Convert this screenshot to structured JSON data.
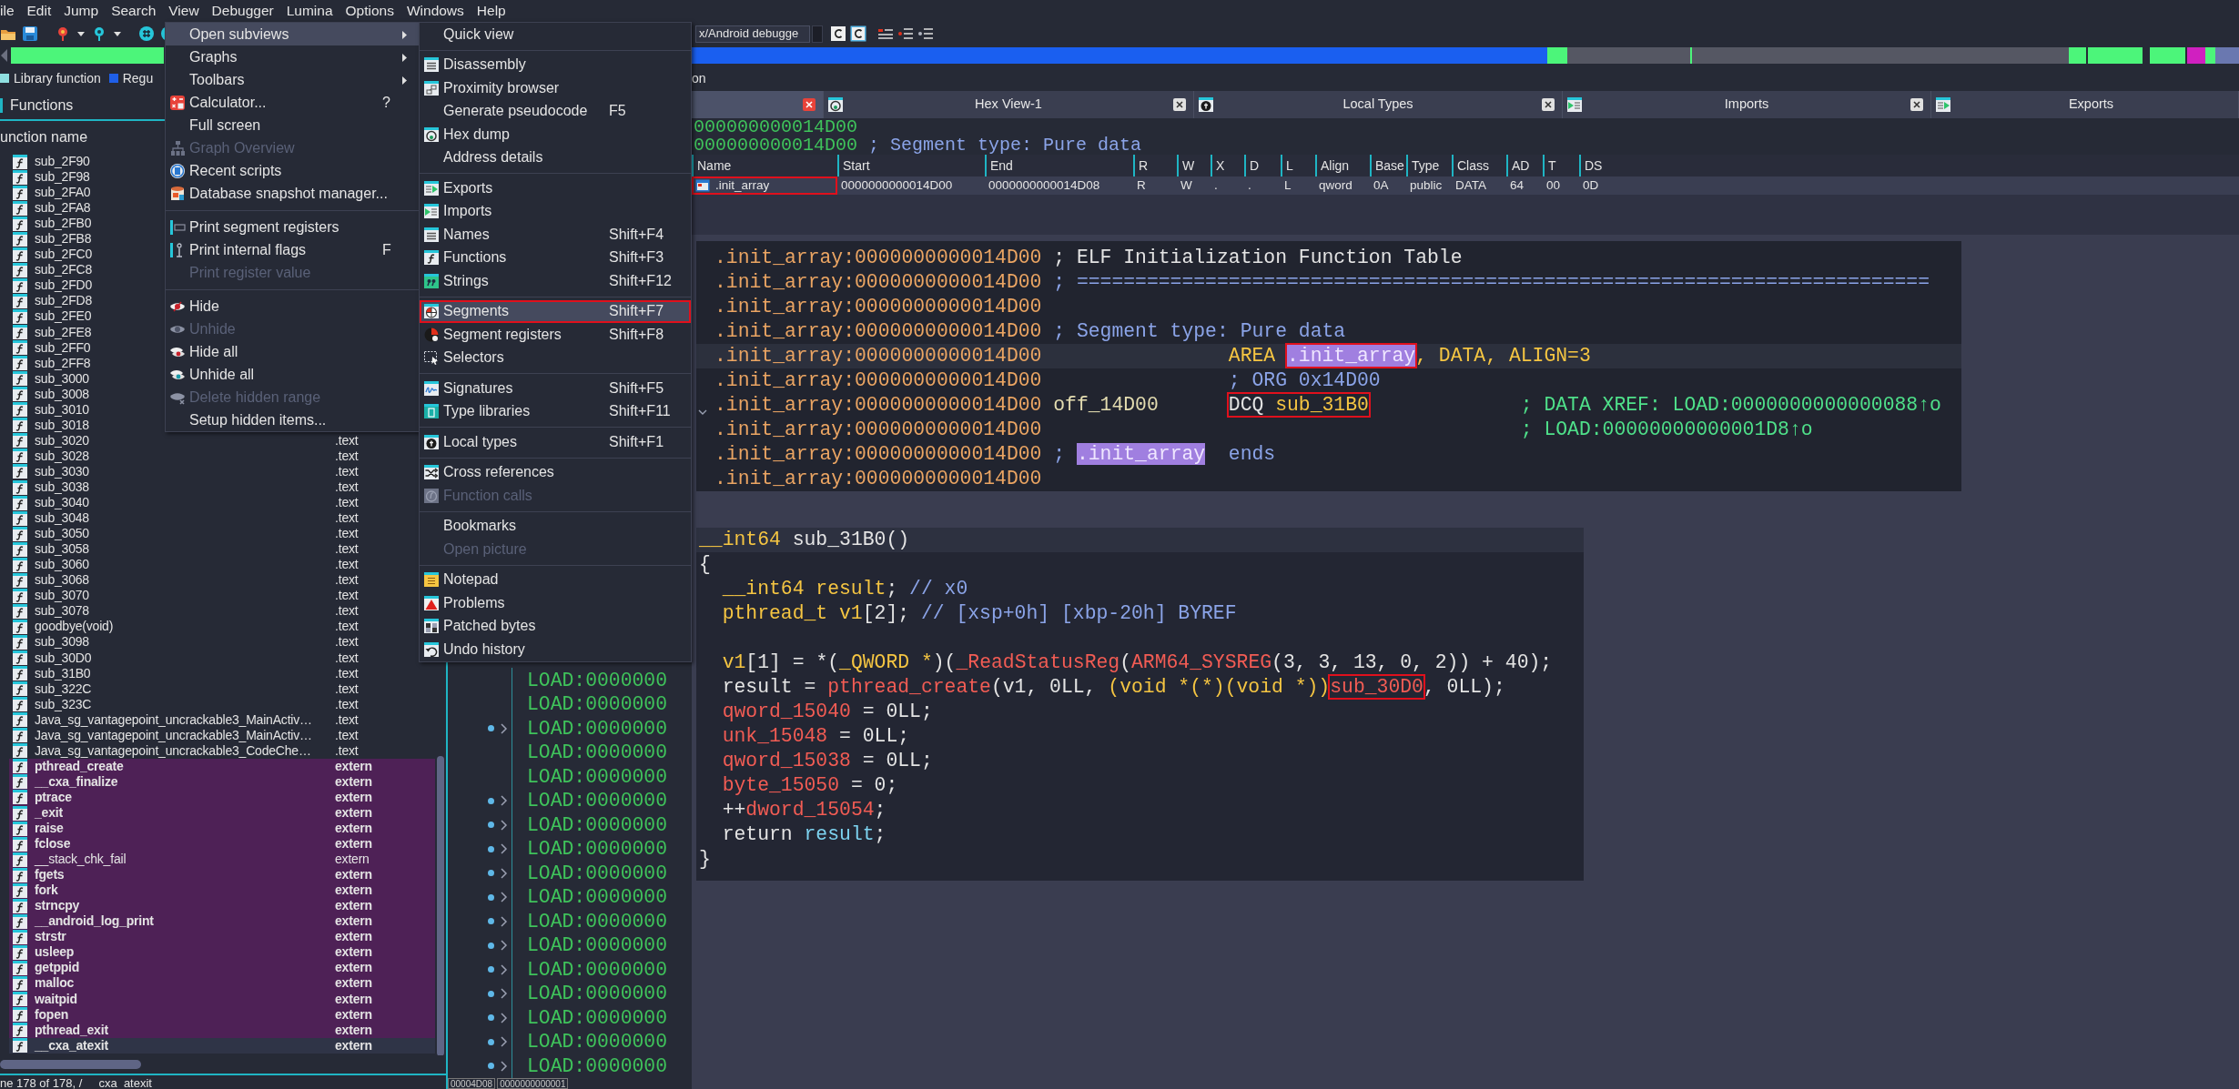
{
  "menubar": [
    "ile",
    "Edit",
    "Jump",
    "Search",
    "View",
    "Debugger",
    "Lumina",
    "Options",
    "Windows",
    "Help"
  ],
  "toolbar": {
    "debugger": "x/Android debugge"
  },
  "legend": [
    {
      "label": "Library function",
      "color": "#8fdfe0"
    },
    {
      "label": "Regu",
      "color": "#1f5fe8"
    }
  ],
  "navigation_label": "on",
  "functions_panel": {
    "title": "Functions",
    "column": "unction name",
    "status": "ne 178 of 178, / __cxa_atexit",
    "rows": [
      {
        "name": "sub_2F90",
        "selected": false,
        "focused": false,
        "bold": false
      },
      {
        "name": "sub_2F98",
        "selected": false,
        "focused": false,
        "bold": false
      },
      {
        "name": "sub_2FA0",
        "selected": false,
        "focused": false,
        "bold": false
      },
      {
        "name": "sub_2FA8",
        "selected": false,
        "focused": false,
        "bold": false
      },
      {
        "name": "sub_2FB0",
        "selected": false,
        "focused": false,
        "bold": false
      },
      {
        "name": "sub_2FB8",
        "selected": false,
        "focused": false,
        "bold": false
      },
      {
        "name": "sub_2FC0",
        "selected": false,
        "focused": false,
        "bold": false
      },
      {
        "name": "sub_2FC8",
        "selected": false,
        "focused": false,
        "bold": false
      },
      {
        "name": "sub_2FD0",
        "selected": false,
        "focused": false,
        "bold": false
      },
      {
        "name": "sub_2FD8",
        "selected": false,
        "focused": false,
        "bold": false
      },
      {
        "name": "sub_2FE0",
        "selected": false,
        "focused": false,
        "bold": false
      },
      {
        "name": "sub_2FE8",
        "selected": false,
        "focused": false,
        "bold": false
      },
      {
        "name": "sub_2FF0",
        "selected": false,
        "focused": false,
        "bold": false
      },
      {
        "name": "sub_2FF8",
        "selected": false,
        "focused": false,
        "bold": false
      },
      {
        "name": "sub_3000",
        "selected": false,
        "focused": false,
        "bold": false
      },
      {
        "name": "sub_3008",
        "selected": false,
        "focused": false,
        "bold": false
      },
      {
        "name": "sub_3010",
        "selected": false,
        "focused": false,
        "bold": false
      },
      {
        "name": "sub_3018",
        "selected": false,
        "focused": false,
        "bold": false
      },
      {
        "name": "sub_3020",
        "segment": ".text",
        "selected": false,
        "focused": false,
        "bold": false
      },
      {
        "name": "sub_3028",
        "segment": ".text",
        "selected": false,
        "focused": false,
        "bold": false
      },
      {
        "name": "sub_3030",
        "segment": ".text",
        "selected": false,
        "focused": false,
        "bold": false
      },
      {
        "name": "sub_3038",
        "segment": ".text",
        "selected": false,
        "focused": false,
        "bold": false
      },
      {
        "name": "sub_3040",
        "segment": ".text",
        "selected": false,
        "focused": false,
        "bold": false
      },
      {
        "name": "sub_3048",
        "segment": ".text",
        "selected": false,
        "focused": false,
        "bold": false
      },
      {
        "name": "sub_3050",
        "segment": ".text",
        "selected": false,
        "focused": false,
        "bold": false
      },
      {
        "name": "sub_3058",
        "segment": ".text",
        "selected": false,
        "focused": false,
        "bold": false
      },
      {
        "name": "sub_3060",
        "segment": ".text",
        "selected": false,
        "focused": false,
        "bold": false
      },
      {
        "name": "sub_3068",
        "segment": ".text",
        "selected": false,
        "focused": false,
        "bold": false
      },
      {
        "name": "sub_3070",
        "segment": ".text",
        "selected": false,
        "focused": false,
        "bold": false
      },
      {
        "name": "sub_3078",
        "segment": ".text",
        "selected": false,
        "focused": false,
        "bold": false
      },
      {
        "name": "goodbye(void)",
        "segment": ".text",
        "selected": false,
        "focused": false,
        "bold": false
      },
      {
        "name": "sub_3098",
        "segment": ".text",
        "selected": false,
        "focused": false,
        "bold": false
      },
      {
        "name": "sub_30D0",
        "segment": ".text",
        "selected": false,
        "focused": false,
        "bold": false
      },
      {
        "name": "sub_31B0",
        "segment": ".text",
        "selected": false,
        "focused": false,
        "bold": false
      },
      {
        "name": "sub_322C",
        "segment": ".text",
        "selected": false,
        "focused": false,
        "bold": false
      },
      {
        "name": "sub_323C",
        "segment": ".text",
        "selected": false,
        "focused": false,
        "bold": false
      },
      {
        "name": "Java_sg_vantagepoint_uncrackable3_MainActiv…",
        "segment": ".text",
        "selected": false,
        "focused": false,
        "bold": false
      },
      {
        "name": "Java_sg_vantagepoint_uncrackable3_MainActiv…",
        "segment": ".text",
        "selected": false,
        "focused": false,
        "bold": false
      },
      {
        "name": "Java_sg_vantagepoint_uncrackable3_CodeChe…",
        "segment": ".text",
        "selected": false,
        "focused": false,
        "bold": false
      },
      {
        "name": "pthread_create",
        "segment": "extern",
        "selected": true,
        "focused": false,
        "bold": true
      },
      {
        "name": "__cxa_finalize",
        "segment": "extern",
        "selected": true,
        "focused": false,
        "bold": true
      },
      {
        "name": "ptrace",
        "segment": "extern",
        "selected": true,
        "focused": false,
        "bold": true
      },
      {
        "name": "_exit",
        "segment": "extern",
        "selected": true,
        "focused": false,
        "bold": true
      },
      {
        "name": "raise",
        "segment": "extern",
        "selected": true,
        "focused": false,
        "bold": true
      },
      {
        "name": "fclose",
        "segment": "extern",
        "selected": true,
        "focused": false,
        "bold": true
      },
      {
        "name": "__stack_chk_fail",
        "segment": "extern",
        "selected": true,
        "focused": false,
        "bold": false
      },
      {
        "name": "fgets",
        "segment": "extern",
        "selected": true,
        "focused": false,
        "bold": true
      },
      {
        "name": "fork",
        "segment": "extern",
        "selected": true,
        "focused": false,
        "bold": true
      },
      {
        "name": "strncpy",
        "segment": "extern",
        "selected": true,
        "focused": false,
        "bold": true
      },
      {
        "name": "__android_log_print",
        "segment": "extern",
        "selected": true,
        "focused": false,
        "bold": true
      },
      {
        "name": "strstr",
        "segment": "extern",
        "selected": true,
        "focused": false,
        "bold": true
      },
      {
        "name": "usleep",
        "segment": "extern",
        "selected": true,
        "focused": false,
        "bold": true
      },
      {
        "name": "getppid",
        "segment": "extern",
        "selected": true,
        "focused": false,
        "bold": true
      },
      {
        "name": "malloc",
        "segment": "extern",
        "selected": true,
        "focused": false,
        "bold": true
      },
      {
        "name": "waitpid",
        "segment": "extern",
        "selected": true,
        "focused": false,
        "bold": true
      },
      {
        "name": "fopen",
        "segment": "extern",
        "selected": true,
        "focused": false,
        "bold": true
      },
      {
        "name": "pthread_exit",
        "segment": "extern",
        "selected": true,
        "focused": false,
        "bold": true
      },
      {
        "name": "__cxa_atexit",
        "segment": "extern",
        "selected": false,
        "focused": true,
        "bold": true
      }
    ]
  },
  "listing": {
    "footer": [
      "00004D08",
      "0000000000001"
    ],
    "lines": [
      {
        "text": "LOAD:0000000",
        "arrow": false
      },
      {
        "text": "LOAD:0000000",
        "arrow": false
      },
      {
        "text": "LOAD:0000000",
        "arrow": true
      },
      {
        "text": "LOAD:0000000",
        "arrow": false
      },
      {
        "text": "LOAD:0000000",
        "arrow": false
      },
      {
        "text": "LOAD:0000000",
        "arrow": true
      },
      {
        "text": "LOAD:0000000",
        "arrow": true
      },
      {
        "text": "LOAD:0000000",
        "arrow": true
      },
      {
        "text": "LOAD:0000000",
        "arrow": true
      },
      {
        "text": "LOAD:0000000",
        "arrow": true
      },
      {
        "text": "LOAD:0000000",
        "arrow": true
      },
      {
        "text": "LOAD:0000000",
        "arrow": true
      },
      {
        "text": "LOAD:0000000",
        "arrow": true
      },
      {
        "text": "LOAD:0000000",
        "arrow": true
      },
      {
        "text": "LOAD:0000000",
        "arrow": true
      },
      {
        "text": "LOAD:0000000",
        "arrow": true
      },
      {
        "text": "LOAD:0000000",
        "arrow": true
      }
    ]
  },
  "tabs": [
    {
      "selected": true,
      "close": true
    },
    {
      "label": "Hex View-1",
      "selected": false,
      "close": true
    },
    {
      "label": "Local Types",
      "selected": false,
      "close": true
    },
    {
      "label": "Imports",
      "selected": false,
      "close": true
    },
    {
      "label": "Exports",
      "selected": false,
      "close": false
    }
  ],
  "ida_view": {
    "lines": [
      [
        {
          "text": "000000000014D00",
          "kind": "loc"
        }
      ],
      [
        {
          "text": "000000000014D00",
          "kind": "loc"
        },
        {
          "text": " ; Segment type: Pure data",
          "kind": "comment"
        }
      ]
    ]
  },
  "segments_window": {
    "columns": [
      "Name",
      "Start",
      "End",
      "R",
      "W",
      "X",
      "D",
      "L",
      "Align",
      "Base",
      "Type",
      "Class",
      "AD",
      "T",
      "DS"
    ],
    "rows": [
      {
        "highlighted": true,
        "values": [
          ".init_array",
          "0000000000014D00",
          "0000000000014D08",
          "R",
          "W",
          ".",
          ".",
          "L",
          "qword",
          "0A",
          "public",
          "DATA",
          "64",
          "00",
          "0D"
        ]
      }
    ]
  },
  "disassembly": {
    "lines": [
      {
        "address": ".init_array:0000000000014D00",
        "current": false,
        "expandable": false,
        "head": [
          {
            "text": "; ELF Initialization Function Table",
            "kind": "plain"
          }
        ]
      },
      {
        "address": ".init_array:0000000000014D00",
        "current": false,
        "expandable": false,
        "head": [
          {
            "text": "; =========================================================================",
            "kind": "comment"
          }
        ]
      },
      {
        "address": ".init_array:0000000000014D00",
        "current": false,
        "expandable": false
      },
      {
        "address": ".init_array:0000000000014D00",
        "current": false,
        "expandable": false,
        "head": [
          {
            "text": "; Segment type: Pure data",
            "kind": "comment"
          }
        ]
      },
      {
        "address": ".init_array:0000000000014D00",
        "current": true,
        "expandable": false,
        "op": [
          {
            "text": "AREA ",
            "kind": "name"
          },
          {
            "text": ".init_array",
            "kind": "name",
            "selected": true,
            "highlighted": true
          },
          {
            "text": ", DATA, ALIGN=3",
            "kind": "name"
          }
        ]
      },
      {
        "address": ".init_array:0000000000014D00",
        "current": false,
        "expandable": false,
        "op": [
          {
            "text": "; ORG 0x14D00",
            "kind": "comment"
          }
        ]
      },
      {
        "address": ".init_array:0000000000014D00",
        "current": false,
        "expandable": true,
        "head": [
          {
            "text": "off_14D00",
            "kind": "label"
          }
        ],
        "op": [
          {
            "highlighted": true,
            "tokens": [
              {
                "text": "DCQ ",
                "kind": "plain"
              },
              {
                "text": "sub_31B0",
                "kind": "name"
              }
            ]
          }
        ],
        "tail": [
          {
            "text": "; DATA XREF: LOAD:0000000000000088↑o",
            "kind": "xref"
          }
        ]
      },
      {
        "address": ".init_array:0000000000014D00",
        "current": false,
        "expandable": false,
        "tail": [
          {
            "text": "; LOAD:00000000000001D8↑o",
            "kind": "xref"
          }
        ]
      },
      {
        "address": ".init_array:0000000000014D00",
        "current": false,
        "expandable": false,
        "head": [
          {
            "text": "; ",
            "kind": "comment"
          },
          {
            "text": ".init_array",
            "kind": "comment",
            "selected": true
          }
        ],
        "op": [
          {
            "text": "ends",
            "kind": "comment"
          }
        ]
      },
      {
        "address": ".init_array:0000000000014D00",
        "current": false,
        "expandable": false
      }
    ]
  },
  "pseudocode": {
    "signature": {
      "current": true,
      "tokens": [
        {
          "text": "__int64",
          "kind": "type"
        },
        {
          "text": " sub_31B0()",
          "kind": "plain"
        }
      ]
    },
    "open": "{",
    "body": [
      {
        "kind": "code",
        "tokens": [
          {
            "text": "__int64 result",
            "kind": "type"
          },
          {
            "text": ";",
            "kind": "plain"
          },
          {
            "text": " // x0",
            "kind": "comment"
          }
        ]
      },
      {
        "kind": "code",
        "tokens": [
          {
            "text": "pthread_t v1",
            "kind": "type"
          },
          {
            "text": "[2];",
            "kind": "plain"
          },
          {
            "text": " // [xsp+0h] [xbp-20h] BYREF",
            "kind": "comment"
          }
        ]
      },
      {
        "kind": "blank"
      },
      {
        "kind": "code",
        "tokens": [
          {
            "text": "v1",
            "kind": "type"
          },
          {
            "text": "[1] = *(",
            "kind": "plain"
          },
          {
            "text": "_QWORD *",
            "kind": "type"
          },
          {
            "text": ")(",
            "kind": "plain"
          },
          {
            "text": "_ReadStatusReg",
            "kind": "func"
          },
          {
            "text": "(",
            "kind": "plain"
          },
          {
            "text": "ARM64_SYSREG",
            "kind": "func"
          },
          {
            "text": "(3, 3, 13, 0, 2)) + 40);",
            "kind": "plain"
          }
        ]
      },
      {
        "kind": "code",
        "tokens": [
          {
            "text": "result = ",
            "kind": "plain"
          },
          {
            "text": "pthread_create",
            "kind": "func"
          },
          {
            "text": "(v1, 0LL, ",
            "kind": "plain"
          },
          {
            "text": "(void *(*)(void *))",
            "kind": "type"
          },
          {
            "text": "sub_30D0",
            "kind": "func",
            "highlighted": true
          },
          {
            "text": ", 0LL);",
            "kind": "plain"
          }
        ]
      },
      {
        "kind": "code",
        "tokens": [
          {
            "text": "qword_15040",
            "kind": "func"
          },
          {
            "text": " = 0LL;",
            "kind": "plain"
          }
        ]
      },
      {
        "kind": "code",
        "tokens": [
          {
            "text": "unk_15048",
            "kind": "func"
          },
          {
            "text": " = 0LL;",
            "kind": "plain"
          }
        ]
      },
      {
        "kind": "code",
        "tokens": [
          {
            "text": "qword_15038",
            "kind": "func"
          },
          {
            "text": " = 0LL;",
            "kind": "plain"
          }
        ]
      },
      {
        "kind": "code",
        "tokens": [
          {
            "text": "byte_15050",
            "kind": "func"
          },
          {
            "text": " = 0;",
            "kind": "plain"
          }
        ]
      },
      {
        "kind": "code",
        "tokens": [
          {
            "text": "++",
            "kind": "plain"
          },
          {
            "text": "dword_15054",
            "kind": "func"
          },
          {
            "text": ";",
            "kind": "plain"
          }
        ]
      },
      {
        "kind": "code",
        "tokens": [
          {
            "text": "return ",
            "kind": "plain"
          },
          {
            "text": "result",
            "kind": "ref"
          },
          {
            "text": ";",
            "kind": "plain"
          }
        ]
      }
    ],
    "close": "}"
  },
  "view_menu": {
    "items": [
      {
        "kind": "item",
        "label": "Open subviews",
        "submenu": true,
        "selected": true,
        "disabled": false
      },
      {
        "kind": "item",
        "label": "Graphs",
        "submenu": true,
        "selected": false,
        "disabled": false
      },
      {
        "kind": "item",
        "label": "Toolbars",
        "submenu": true,
        "selected": false,
        "disabled": false
      },
      {
        "kind": "item",
        "label": "Calculator...",
        "shortcut": "?",
        "submenu": false,
        "selected": false,
        "disabled": false
      },
      {
        "kind": "item",
        "label": "Full screen",
        "submenu": false,
        "selected": false,
        "disabled": false
      },
      {
        "kind": "item",
        "label": "Graph Overview",
        "submenu": false,
        "selected": false,
        "disabled": true
      },
      {
        "kind": "item",
        "label": "Recent scripts",
        "submenu": false,
        "selected": false,
        "disabled": false
      },
      {
        "kind": "item",
        "label": "Database snapshot manager...",
        "submenu": false,
        "selected": false,
        "disabled": false
      },
      {
        "kind": "separator"
      },
      {
        "kind": "item",
        "label": "Print segment registers",
        "submenu": false,
        "selected": false,
        "disabled": false
      },
      {
        "kind": "item",
        "label": "Print internal flags",
        "shortcut": "F",
        "submenu": false,
        "selected": false,
        "disabled": false
      },
      {
        "kind": "item",
        "label": "Print register value",
        "submenu": false,
        "selected": false,
        "disabled": true
      },
      {
        "kind": "separator"
      },
      {
        "kind": "item",
        "label": "Hide",
        "submenu": false,
        "selected": false,
        "disabled": false
      },
      {
        "kind": "item",
        "label": "Unhide",
        "submenu": false,
        "selected": false,
        "disabled": true
      },
      {
        "kind": "item",
        "label": "Hide all",
        "submenu": false,
        "selected": false,
        "disabled": false
      },
      {
        "kind": "item",
        "label": "Unhide all",
        "submenu": false,
        "selected": false,
        "disabled": false
      },
      {
        "kind": "item",
        "label": "Delete hidden range",
        "submenu": false,
        "selected": false,
        "disabled": true
      },
      {
        "kind": "item",
        "label": "Setup hidden items...",
        "submenu": false,
        "selected": false,
        "disabled": false
      }
    ]
  },
  "subviews_menu": {
    "items": [
      {
        "kind": "item",
        "label": "Quick view",
        "selected": false,
        "disabled": false,
        "highlighted": false
      },
      {
        "kind": "separator"
      },
      {
        "kind": "item",
        "label": "Disassembly",
        "selected": false,
        "disabled": false,
        "highlighted": false
      },
      {
        "kind": "item",
        "label": "Proximity browser",
        "selected": false,
        "disabled": false,
        "highlighted": false
      },
      {
        "kind": "item",
        "label": "Generate pseudocode",
        "shortcut": "F5",
        "selected": false,
        "disabled": false,
        "highlighted": false
      },
      {
        "kind": "item",
        "label": "Hex dump",
        "selected": false,
        "disabled": false,
        "highlighted": false
      },
      {
        "kind": "item",
        "label": "Address details",
        "selected": false,
        "disabled": false,
        "highlighted": false
      },
      {
        "kind": "separator"
      },
      {
        "kind": "item",
        "label": "Exports",
        "selected": false,
        "disabled": false,
        "highlighted": false
      },
      {
        "kind": "item",
        "label": "Imports",
        "selected": false,
        "disabled": false,
        "highlighted": false
      },
      {
        "kind": "item",
        "label": "Names",
        "shortcut": "Shift+F4",
        "selected": false,
        "disabled": false,
        "highlighted": false
      },
      {
        "kind": "item",
        "label": "Functions",
        "shortcut": "Shift+F3",
        "selected": false,
        "disabled": false,
        "highlighted": false
      },
      {
        "kind": "item",
        "label": "Strings",
        "shortcut": "Shift+F12",
        "selected": false,
        "disabled": false,
        "highlighted": false
      },
      {
        "kind": "separator"
      },
      {
        "kind": "item",
        "label": "Segments",
        "shortcut": "Shift+F7",
        "selected": true,
        "disabled": false,
        "highlighted": true
      },
      {
        "kind": "item",
        "label": "Segment registers",
        "shortcut": "Shift+F8",
        "selected": false,
        "disabled": false,
        "highlighted": false
      },
      {
        "kind": "item",
        "label": "Selectors",
        "selected": false,
        "disabled": false,
        "highlighted": false
      },
      {
        "kind": "separator"
      },
      {
        "kind": "item",
        "label": "Signatures",
        "shortcut": "Shift+F5",
        "selected": false,
        "disabled": false,
        "highlighted": false
      },
      {
        "kind": "item",
        "label": "Type libraries",
        "shortcut": "Shift+F11",
        "selected": false,
        "disabled": false,
        "highlighted": false
      },
      {
        "kind": "separator"
      },
      {
        "kind": "item",
        "label": "Local types",
        "shortcut": "Shift+F1",
        "selected": false,
        "disabled": false,
        "highlighted": false
      },
      {
        "kind": "separator"
      },
      {
        "kind": "item",
        "label": "Cross references",
        "selected": false,
        "disabled": false,
        "highlighted": false
      },
      {
        "kind": "item",
        "label": "Function calls",
        "selected": false,
        "disabled": true,
        "highlighted": false
      },
      {
        "kind": "separator"
      },
      {
        "kind": "item",
        "label": "Bookmarks",
        "selected": false,
        "disabled": false,
        "highlighted": false
      },
      {
        "kind": "item",
        "label": "Open picture",
        "selected": false,
        "disabled": true,
        "highlighted": false
      },
      {
        "kind": "separator"
      },
      {
        "kind": "item",
        "label": "Notepad",
        "selected": false,
        "disabled": false,
        "highlighted": false
      },
      {
        "kind": "item",
        "label": "Problems",
        "selected": false,
        "disabled": false,
        "highlighted": false
      },
      {
        "kind": "item",
        "label": "Patched bytes",
        "selected": false,
        "disabled": false,
        "highlighted": false
      },
      {
        "kind": "item",
        "label": "Undo history",
        "selected": false,
        "disabled": false,
        "highlighted": false
      }
    ]
  }
}
